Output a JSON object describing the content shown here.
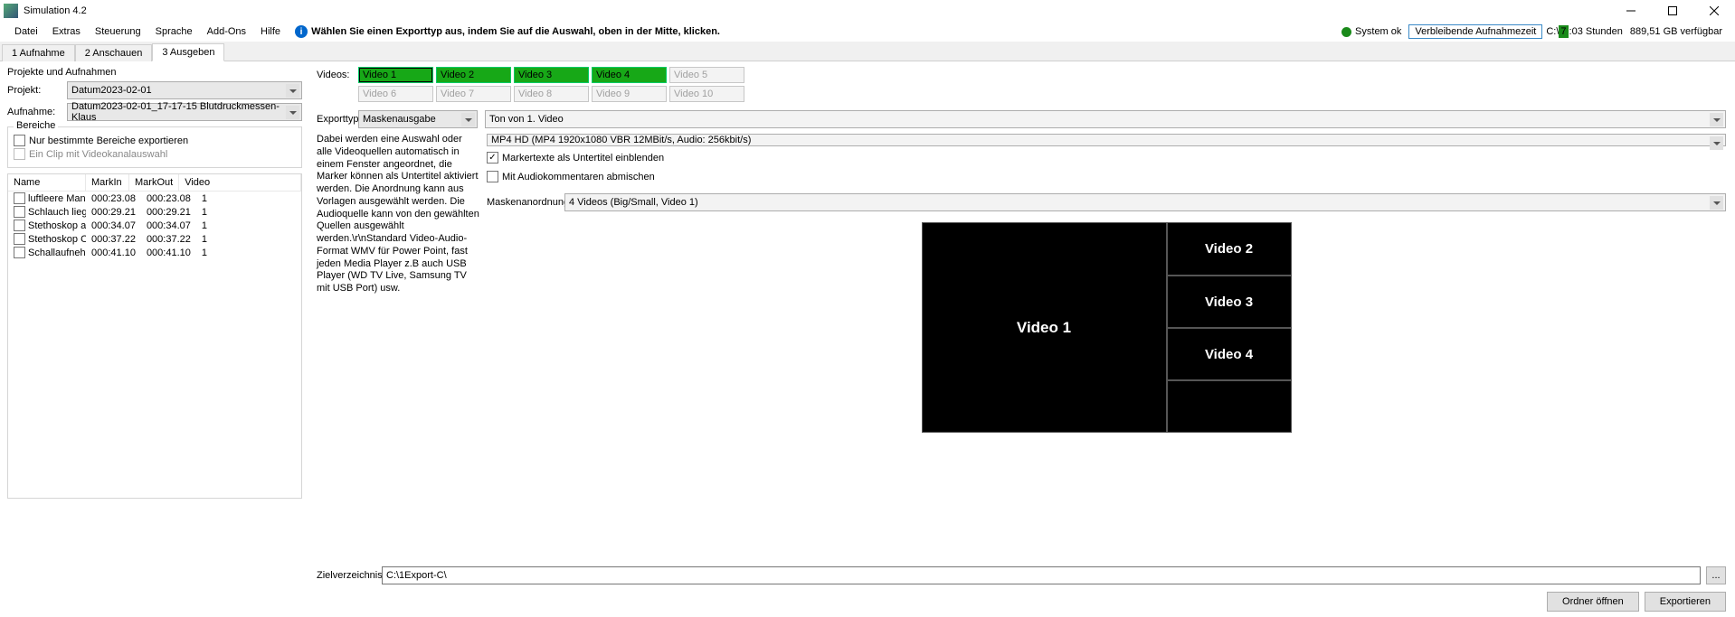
{
  "window": {
    "title": "Simulation 4.2"
  },
  "menu": {
    "items": [
      "Datei",
      "Extras",
      "Steuerung",
      "Sprache",
      "Add-Ons",
      "Hilfe"
    ],
    "hint": "Wählen Sie einen Exporttyp aus, indem Sie auf die Auswahl, oben in der Mitte, klicken.",
    "status": "System ok",
    "rectime_label": "Verbleibende Aufnahmezeit",
    "drive": "C:\\",
    "time_prefix": "7",
    "time_suffix": ":03 Stunden",
    "free": "889,51 GB verfügbar"
  },
  "tabs": {
    "t1": "1 Aufnahme",
    "t2": "2 Anschauen",
    "t3": "3 Ausgeben"
  },
  "left": {
    "section": "Projekte und Aufnahmen",
    "project_label": "Projekt:",
    "project_value": "Datum2023-02-01",
    "rec_label": "Aufnahme:",
    "rec_value": "Datum2023-02-01_17-17-15 Blutdruckmessen-Klaus",
    "areas_legend": "Bereiche",
    "only_areas": "Nur bestimmte Bereiche exportieren",
    "one_clip": "Ein Clip mit Videokanalauswahl",
    "cols": {
      "name": "Name",
      "markin": "MarkIn",
      "markout": "MarkOut",
      "video": "Video"
    },
    "rows": [
      {
        "name": "luftleere Mans...",
        "mi": "000:23.08",
        "mo": "000:23.08",
        "v": "1"
      },
      {
        "name": "Schlauch liegt ...",
        "mi": "000:29.21",
        "mo": "000:29.21",
        "v": "1"
      },
      {
        "name": "Stethoskop an...",
        "mi": "000:34.07",
        "mo": "000:34.07",
        "v": "1"
      },
      {
        "name": "Stethoskop O...",
        "mi": "000:37.22",
        "mo": "000:37.22",
        "v": "1"
      },
      {
        "name": "Schallaufnehm...",
        "mi": "000:41.10",
        "mo": "000:41.10",
        "v": "1"
      }
    ]
  },
  "right": {
    "videos_label": "Videos:",
    "vbtns": [
      "Video 1",
      "Video 2",
      "Video 3",
      "Video 4",
      "Video 5",
      "Video 6",
      "Video 7",
      "Video 8",
      "Video 9",
      "Video 10"
    ],
    "exporttype_label": "Exporttyp:",
    "exporttype_value": "Maskenausgabe",
    "tone_value": "Ton von 1. Video",
    "desc": "Dabei werden eine Auswahl oder alle Videoquellen automatisch in einem Fenster angeordnet, die Marker können als Untertitel aktiviert werden. Die Anordnung kann aus Vorlagen ausgewählt werden. Die Audioquelle kann von den gewählten Quellen ausgewählt werden.\\r\\nStandard Video-Audio-Format WMV für Power Point, fast jeden Media Player z.B auch USB Player (WD TV Live, Samsung TV mit USB Port) usw.",
    "format_value": "MP4 HD (MP4 1920x1080 VBR 12MBit/s, Audio: 256kbit/s)",
    "chk_marker": "Markertexte als Untertitel einblenden",
    "chk_audio": "Mit Audiokommentaren abmischen",
    "mask_label": "Maskenanordnung:",
    "mask_value": "4 Videos (Big/Small, Video 1)",
    "preview": {
      "big": "Video 1",
      "s1": "Video 2",
      "s2": "Video 3",
      "s3": "Video 4"
    },
    "target_label": "Zielverzeichnis:",
    "target_value": "C:\\1Export-C\\",
    "browse": "...",
    "btn_open": "Ordner öffnen",
    "btn_export": "Exportieren"
  }
}
